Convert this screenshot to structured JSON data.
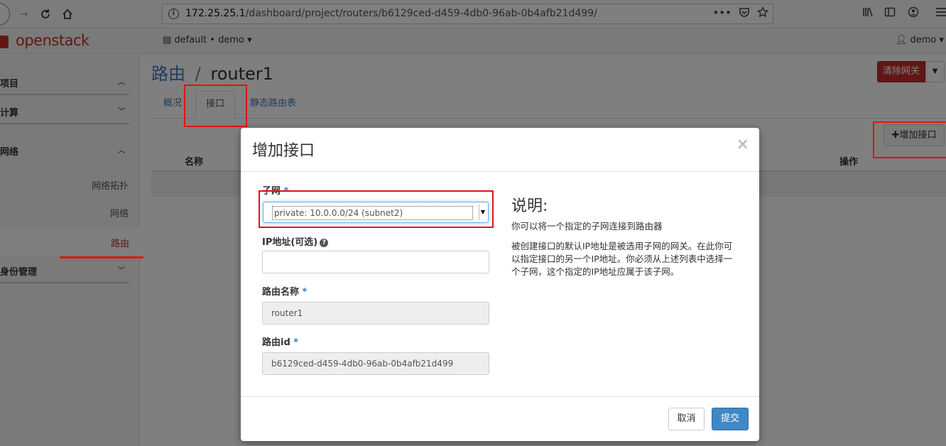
{
  "browser": {
    "url_host": "172.25.25.1",
    "url_path": "/dashboard/project/routers/b6129ced-d459-4db0-96ab-0b4afb21d499/",
    "dots": "•••"
  },
  "header": {
    "logo": "openstack",
    "project": "default • demo ▾",
    "user": "demo ▾"
  },
  "sidebar": {
    "project": "项目",
    "compute": "计算",
    "network": "网络",
    "topology": "网络拓扑",
    "networks": "网络",
    "routers": "路由",
    "identity": "身份管理"
  },
  "page": {
    "breadcrumb": "路由",
    "sep": "/",
    "title": "router1",
    "clear_gateway": "清除网关",
    "tabs": [
      "概况",
      "接口",
      "静态路由表"
    ],
    "add_interface": "增加接口",
    "col_name": "名称",
    "col_actions": "操作"
  },
  "modal": {
    "title": "增加接口",
    "close": "×",
    "subnet_label": "子网",
    "required": "*",
    "subnet_value": "private: 10.0.0.0/24 (subnet2)",
    "ip_label": "IP地址(可选)",
    "router_name_label": "路由名称",
    "router_name_value": "router1",
    "router_id_label": "路由id",
    "router_id_value": "b6129ced-d459-4db0-96ab-0b4afb21d499",
    "desc_title": "说明:",
    "desc_p1": "你可以将一个指定的子网连接到路由器",
    "desc_p2": "被创建接口的默认IP地址是被选用子网的网关。在此你可以指定接口的另一个IP地址。你必须从上述列表中选择一个子网，这个指定的IP地址应属于该子网。",
    "cancel": "取消",
    "submit": "提交"
  },
  "colors": {
    "brand": "#c62e2a",
    "link": "#3f7ab8",
    "annotation": "#e3150e"
  }
}
